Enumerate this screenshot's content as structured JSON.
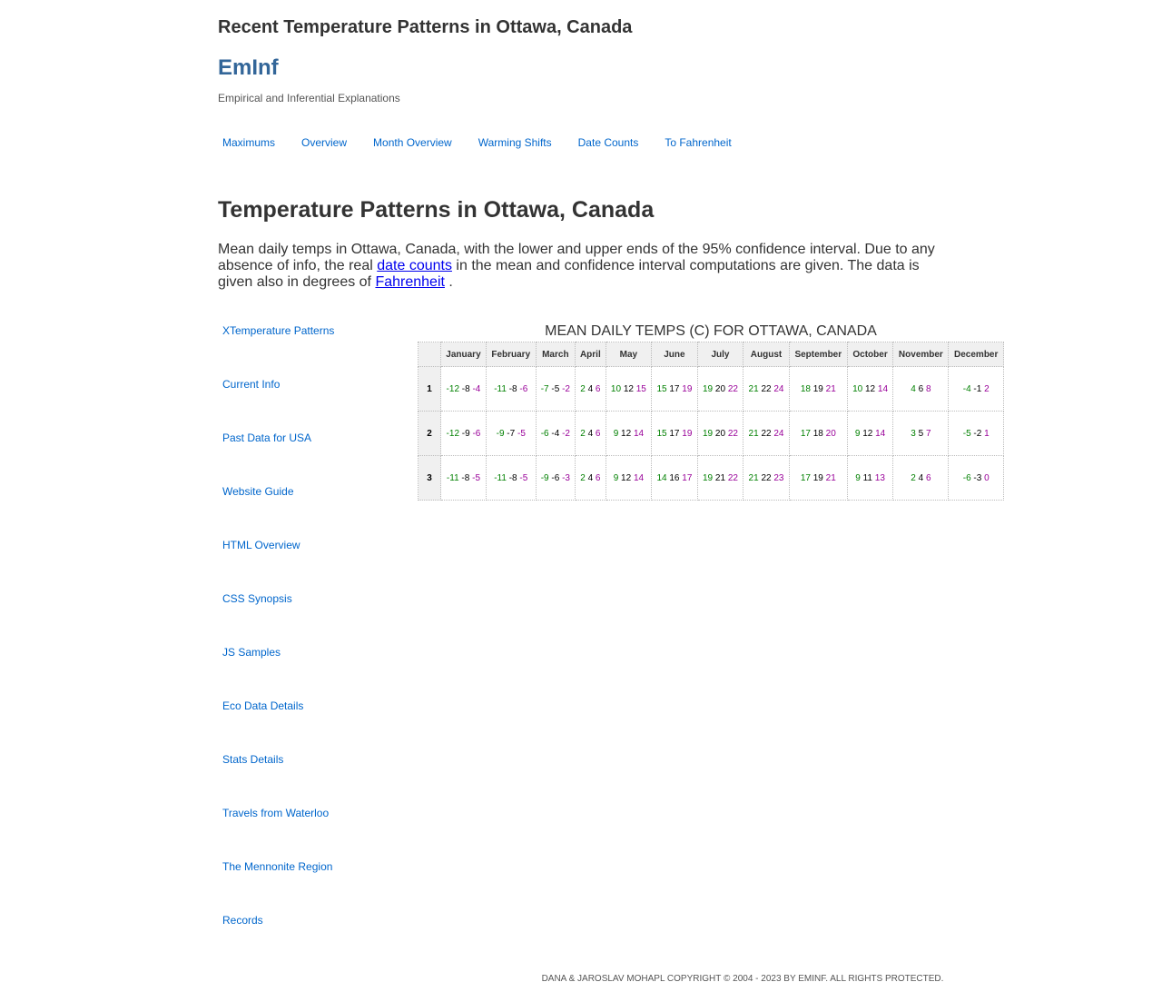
{
  "header": {
    "top_title": "Recent Temperature Patterns in Ottawa, Canada",
    "brand": "EmInf",
    "tagline": "Empirical and Inferential Explanations"
  },
  "topnav": [
    "Maximums",
    "Overview",
    "Month Overview",
    "Warming Shifts",
    "Date Counts",
    "To Fahrenheit"
  ],
  "main": {
    "title": "Temperature Patterns in Ottawa, Canada",
    "intro_part1": "Mean daily temps in Ottawa, Canada, with the lower and upper ends of the 95% confidence interval. Due to any absence of info, the real ",
    "intro_link1": "date counts",
    "intro_part2": " in the mean and confidence interval computations are given. The data is given also in degrees of ",
    "intro_link2": "Fahrenheit",
    "intro_part3": " ."
  },
  "sidenav": [
    "XTemperature Patterns",
    "Current Info",
    "Past Data for USA",
    "Website Guide",
    "HTML Overview",
    "CSS Synopsis",
    "JS Samples",
    "Eco Data Details",
    "Stats Details",
    "Travels from Waterloo",
    "The Mennonite Region",
    "Records"
  ],
  "table": {
    "caption": "MEAN DAILY TEMPS (C) FOR OTTAWA, CANADA",
    "months": [
      "January",
      "February",
      "March",
      "April",
      "May",
      "June",
      "July",
      "August",
      "September",
      "October",
      "November",
      "December"
    ],
    "rows": [
      {
        "day": "1",
        "cells": [
          [
            "-12",
            "-8",
            "-4"
          ],
          [
            "-11",
            "-8",
            "-6"
          ],
          [
            "-7",
            "-5",
            "-2"
          ],
          [
            "2",
            "4",
            "6"
          ],
          [
            "10",
            "12",
            "15"
          ],
          [
            "15",
            "17",
            "19"
          ],
          [
            "19",
            "20",
            "22"
          ],
          [
            "21",
            "22",
            "24"
          ],
          [
            "18",
            "19",
            "21"
          ],
          [
            "10",
            "12",
            "14"
          ],
          [
            "4",
            "6",
            "8"
          ],
          [
            "-4",
            "-1",
            "2"
          ]
        ]
      },
      {
        "day": "2",
        "cells": [
          [
            "-12",
            "-9",
            "-6"
          ],
          [
            "-9",
            "-7",
            "-5"
          ],
          [
            "-6",
            "-4",
            "-2"
          ],
          [
            "2",
            "4",
            "6"
          ],
          [
            "9",
            "12",
            "14"
          ],
          [
            "15",
            "17",
            "19"
          ],
          [
            "19",
            "20",
            "22"
          ],
          [
            "21",
            "22",
            "24"
          ],
          [
            "17",
            "18",
            "20"
          ],
          [
            "9",
            "12",
            "14"
          ],
          [
            "3",
            "5",
            "7"
          ],
          [
            "-5",
            "-2",
            "1"
          ]
        ]
      },
      {
        "day": "3",
        "cells": [
          [
            "-11",
            "-8",
            "-5"
          ],
          [
            "-11",
            "-8",
            "-5"
          ],
          [
            "-9",
            "-6",
            "-3"
          ],
          [
            "2",
            "4",
            "6"
          ],
          [
            "9",
            "12",
            "14"
          ],
          [
            "14",
            "16",
            "17"
          ],
          [
            "19",
            "21",
            "22"
          ],
          [
            "21",
            "22",
            "23"
          ],
          [
            "17",
            "19",
            "21"
          ],
          [
            "9",
            "11",
            "13"
          ],
          [
            "2",
            "4",
            "6"
          ],
          [
            "-6",
            "-3",
            "0"
          ]
        ]
      }
    ]
  },
  "footer": "DANA & JAROSLAV MOHAPL COPYRIGHT © 2004 - 2023 BY EMINF. ALL RIGHTS PROTECTED.",
  "colors": {
    "low": "#008000",
    "mean": "#000000",
    "high": "#990099",
    "link": "#0066cc",
    "brand": "#336699"
  }
}
